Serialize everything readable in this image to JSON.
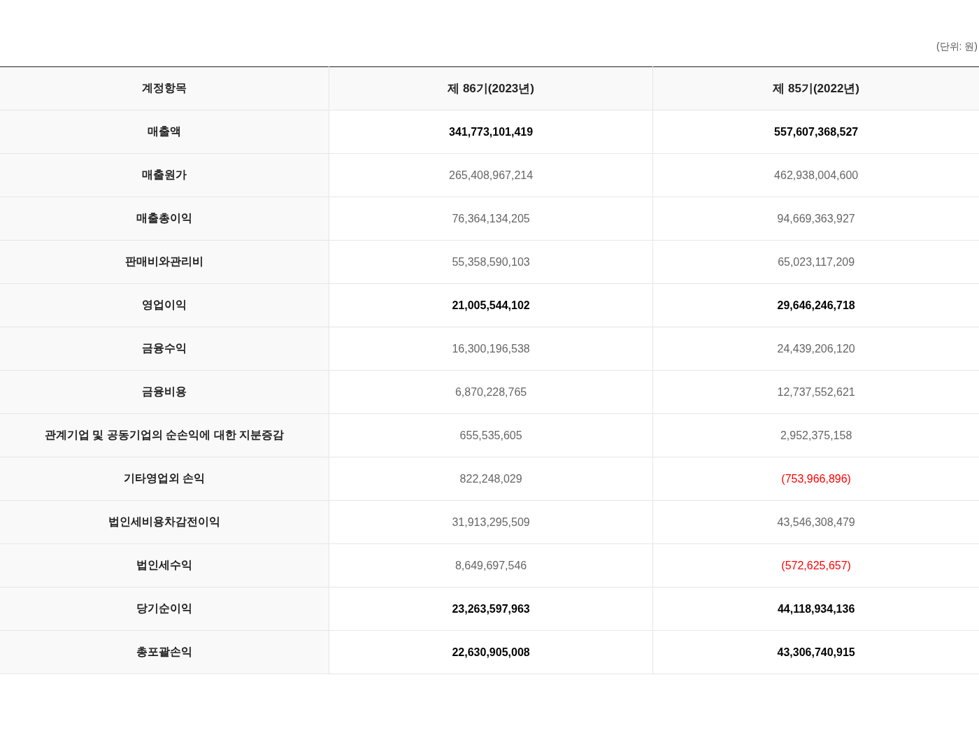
{
  "unit_note": "(단위: 원)",
  "table": {
    "columns": [
      "계정항목",
      "제 86기(2023년)",
      "제 85기(2022년)"
    ],
    "rows": [
      {
        "label": "매출액",
        "kind": "total",
        "values": [
          {
            "text": "341,773,101,419",
            "negative": false
          },
          {
            "text": "557,607,368,527",
            "negative": false
          }
        ]
      },
      {
        "label": "매출원가",
        "kind": "detail",
        "values": [
          {
            "text": "265,408,967,214",
            "negative": false
          },
          {
            "text": "462,938,004,600",
            "negative": false
          }
        ]
      },
      {
        "label": "매출총이익",
        "kind": "detail",
        "values": [
          {
            "text": "76,364,134,205",
            "negative": false
          },
          {
            "text": "94,669,363,927",
            "negative": false
          }
        ]
      },
      {
        "label": "판매비와관리비",
        "kind": "detail",
        "values": [
          {
            "text": "55,358,590,103",
            "negative": false
          },
          {
            "text": "65,023,117,209",
            "negative": false
          }
        ]
      },
      {
        "label": "영업이익",
        "kind": "total",
        "values": [
          {
            "text": "21,005,544,102",
            "negative": false
          },
          {
            "text": "29,646,246,718",
            "negative": false
          }
        ]
      },
      {
        "label": "금융수익",
        "kind": "detail",
        "values": [
          {
            "text": "16,300,196,538",
            "negative": false
          },
          {
            "text": "24,439,206,120",
            "negative": false
          }
        ]
      },
      {
        "label": "금융비용",
        "kind": "detail",
        "values": [
          {
            "text": "6,870,228,765",
            "negative": false
          },
          {
            "text": "12,737,552,621",
            "negative": false
          }
        ]
      },
      {
        "label": "관계기업 및 공동기업의 순손익에 대한 지분증감",
        "kind": "detail",
        "values": [
          {
            "text": "655,535,605",
            "negative": false
          },
          {
            "text": "2,952,375,158",
            "negative": false
          }
        ]
      },
      {
        "label": "기타영업외 손익",
        "kind": "detail",
        "values": [
          {
            "text": "822,248,029",
            "negative": false
          },
          {
            "text": "(753,966,896)",
            "negative": true
          }
        ]
      },
      {
        "label": "법인세비용차감전이익",
        "kind": "detail",
        "values": [
          {
            "text": "31,913,295,509",
            "negative": false
          },
          {
            "text": "43,546,308,479",
            "negative": false
          }
        ]
      },
      {
        "label": "법인세수익",
        "kind": "detail",
        "values": [
          {
            "text": "8,649,697,546",
            "negative": false
          },
          {
            "text": "(572,625,657)",
            "negative": true
          }
        ]
      },
      {
        "label": "당기순이익",
        "kind": "total",
        "values": [
          {
            "text": "23,263,597,963",
            "negative": false
          },
          {
            "text": "44,118,934,136",
            "negative": false
          }
        ]
      },
      {
        "label": "총포괄손익",
        "kind": "total",
        "values": [
          {
            "text": "22,630,905,008",
            "negative": false
          },
          {
            "text": "43,306,740,915",
            "negative": false
          }
        ]
      }
    ]
  }
}
